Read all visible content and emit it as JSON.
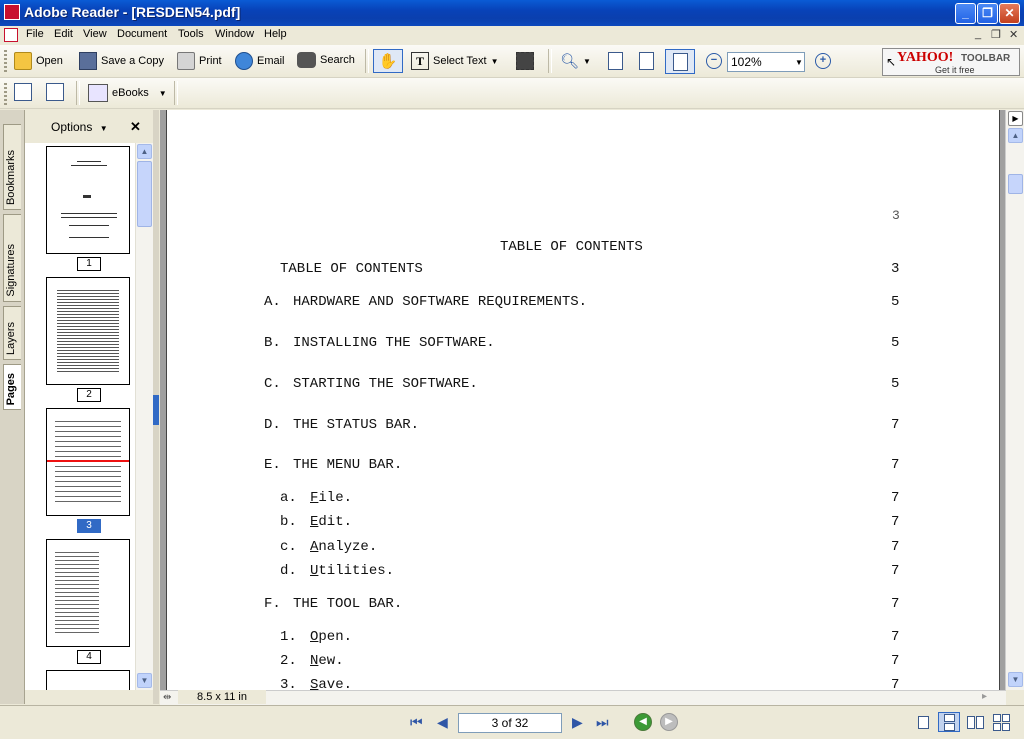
{
  "window": {
    "title": "Adobe Reader - [RESDEN54.pdf]",
    "minimize_glyph": "_",
    "maximize_glyph": "❐",
    "close_glyph": "✕"
  },
  "menu": {
    "items": [
      "File",
      "Edit",
      "View",
      "Document",
      "Tools",
      "Window",
      "Help"
    ],
    "doc_minimize": "_",
    "doc_restore": "❐",
    "doc_close": "✕"
  },
  "toolbar": {
    "open": "Open",
    "save_copy": "Save a Copy",
    "print": "Print",
    "email": "Email",
    "search": "Search",
    "select_text": "Select Text",
    "zoom": "102%",
    "ebooks": "eBooks"
  },
  "yahoo": {
    "logo": "YAHOO!",
    "toolbar": "TOOLBAR",
    "tagline": "Get it free"
  },
  "navigation": {
    "tabs": [
      "Bookmarks",
      "Signatures",
      "Layers",
      "Pages"
    ],
    "options_label": "Options",
    "close_glyph": "✕",
    "thumbnails": [
      {
        "label": "1"
      },
      {
        "label": "2"
      },
      {
        "label": "3",
        "selected": true
      },
      {
        "label": "4"
      }
    ]
  },
  "document": {
    "page_number_top": "3",
    "heading": "TABLE OF CONTENTS",
    "entries": [
      {
        "marker": "",
        "text": "TABLE OF CONTENTS",
        "page": "3",
        "indent": 1
      },
      {
        "marker": "A.",
        "text": "HARDWARE AND SOFTWARE REQUIREMENTS.",
        "page": "5",
        "indent": 0
      },
      {
        "marker": "B.",
        "text": "INSTALLING THE SOFTWARE.",
        "page": "5",
        "indent": 0
      },
      {
        "marker": "C.",
        "text": "STARTING THE SOFTWARE.",
        "page": "5",
        "indent": 0
      },
      {
        "marker": "D.",
        "text": "THE STATUS BAR.",
        "page": "7",
        "indent": 0
      },
      {
        "marker": "E.",
        "text": "THE MENU BAR.",
        "page": "7",
        "indent": 0
      },
      {
        "marker": "a.",
        "first": "F",
        "text": "ile.",
        "page": "7",
        "indent": 1
      },
      {
        "marker": "b.",
        "first": "E",
        "text": "dit.",
        "page": "7",
        "indent": 1
      },
      {
        "marker": "c.",
        "first": "A",
        "text": "nalyze.",
        "page": "7",
        "indent": 1
      },
      {
        "marker": "d.",
        "first": "U",
        "text": "tilities.",
        "page": "7",
        "indent": 1
      },
      {
        "marker": "F.",
        "text": "THE TOOL BAR.",
        "page": "7",
        "indent": 0
      },
      {
        "marker": "1.",
        "first": "O",
        "text": "pen.",
        "page": "7",
        "indent": 1
      },
      {
        "marker": "2.",
        "first": "N",
        "text": "ew.",
        "page": "7",
        "indent": 1
      },
      {
        "marker": "3.",
        "first": "S",
        "text": "ave.",
        "page": "7",
        "indent": 1
      }
    ]
  },
  "footer": {
    "page_size": "8.5 x 11 in",
    "page_indicator": "3 of 32"
  }
}
